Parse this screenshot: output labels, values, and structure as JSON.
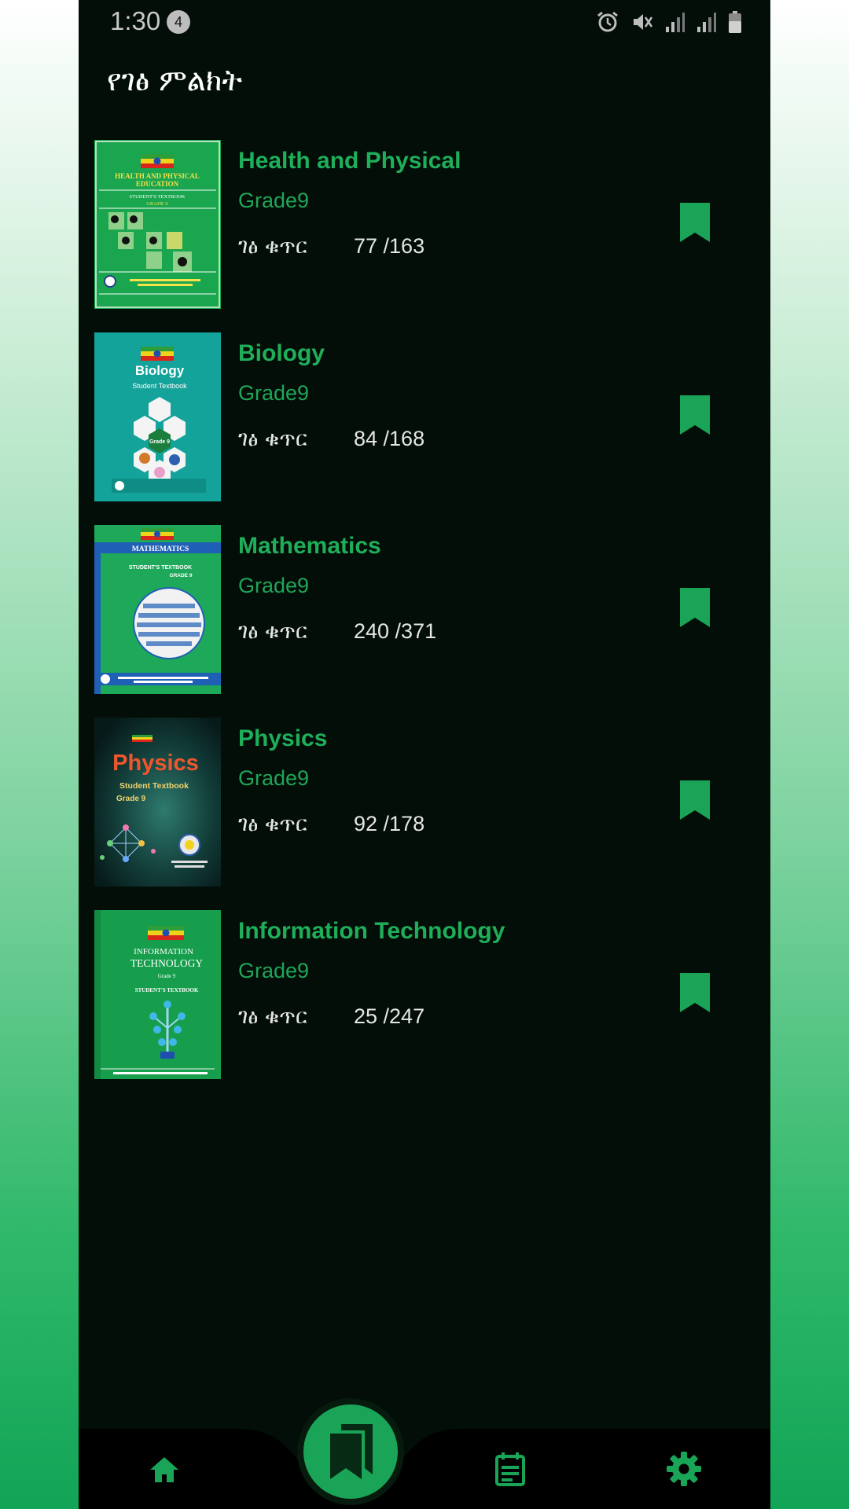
{
  "status_bar": {
    "time": "1:30",
    "notification_count": "4",
    "icons": [
      "alarm-icon",
      "mute-icon",
      "signal-icon",
      "signal-icon",
      "battery-icon"
    ]
  },
  "header": {
    "title": "የገፅ ምልክት"
  },
  "books": [
    {
      "title": "Health and Physical",
      "grade": "Grade9",
      "page_label": "ገፅ ቁጥር",
      "page": "77",
      "total": "163",
      "page_text": "77 /163",
      "cover_color": "#1aa54f",
      "cover": {
        "title1": "HEALTH AND PHYSICAL",
        "title2": "EDUCATION",
        "sub": "STUDENT'S TEXTBOOK",
        "grade": "GRADE 9"
      }
    },
    {
      "title": "Biology",
      "grade": "Grade9",
      "page_label": "ገፅ ቁጥር",
      "page": "84",
      "total": "168",
      "page_text": "84 /168",
      "cover_color": "#13a39a",
      "cover": {
        "title1": "Biology",
        "sub": "Student Textbook",
        "grade": "Grade 9"
      }
    },
    {
      "title": "Mathematics",
      "grade": "Grade9",
      "page_label": "ገፅ ቁጥር",
      "page": "240",
      "total": "371",
      "page_text": "240 /371",
      "cover_color": "#1ea859",
      "cover": {
        "title1": "MATHEMATICS",
        "sub": "STUDENT'S TEXTBOOK",
        "grade": "GRADE 9"
      }
    },
    {
      "title": "Physics",
      "grade": "Grade9",
      "page_label": "ገፅ ቁጥር",
      "page": "92",
      "total": "178",
      "page_text": "92 /178",
      "cover_color": "#0f3b35",
      "cover": {
        "title1": "Physics",
        "sub": "Student Textbook",
        "grade": "Grade 9"
      }
    },
    {
      "title": "Information Technology",
      "grade": "Grade9",
      "page_label": "ገፅ ቁጥር",
      "page": "25",
      "total": "247",
      "page_text": "25 /247",
      "cover_color": "#169e4c",
      "cover": {
        "title1": "INFORMATION",
        "title2": "TECHNOLOGY",
        "sub": "STUDENT'S TEXTBOOK",
        "grade": "Grade 9"
      }
    }
  ],
  "bottom_nav": {
    "items": [
      {
        "icon": "home-icon"
      },
      {
        "icon": "bookmarks-icon",
        "active": true
      },
      {
        "icon": "notes-icon"
      },
      {
        "icon": "settings-icon"
      }
    ]
  },
  "colors": {
    "accent": "#1aa457",
    "background": "#020e07",
    "title_green": "#1fae5a"
  }
}
